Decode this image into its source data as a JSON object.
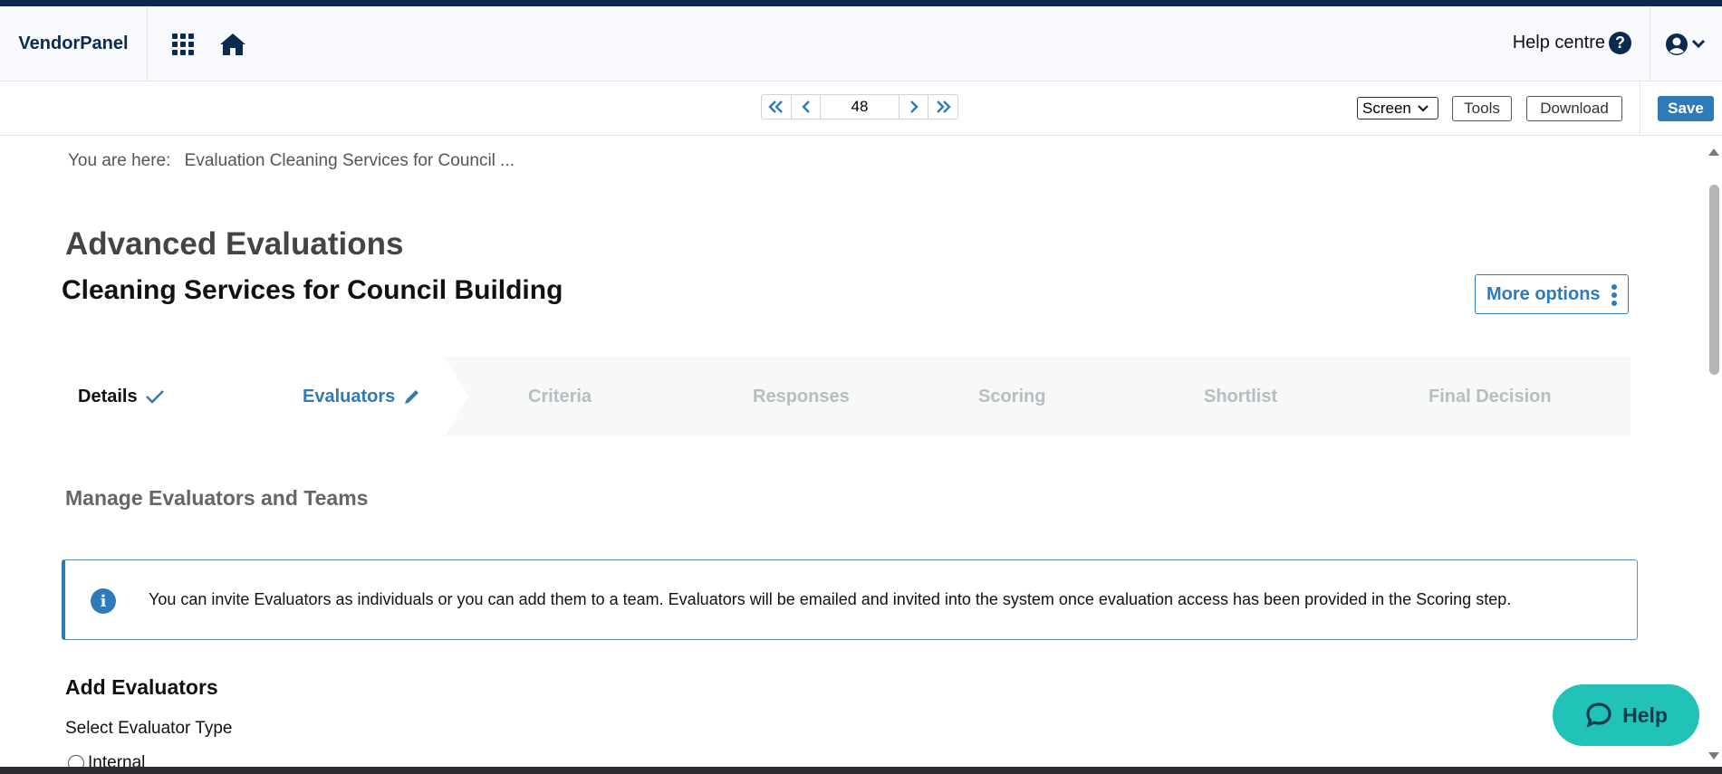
{
  "header": {
    "brand": "VendorPanel",
    "help_centre": "Help centre",
    "help_icon_glyph": "?"
  },
  "toolbar": {
    "page_number": "48",
    "view_select": "Screen",
    "tools_label": "Tools",
    "download_label": "Download",
    "save_label": "Save"
  },
  "breadcrumb": {
    "prefix": "You are here:",
    "current": "Evaluation Cleaning Services for Council ..."
  },
  "page": {
    "title": "Advanced Evaluations",
    "subtitle": "Cleaning Services for Council Building",
    "more_options_label": "More options"
  },
  "stepper": {
    "steps": [
      {
        "label": "Details",
        "state": "done"
      },
      {
        "label": "Evaluators",
        "state": "active"
      },
      {
        "label": "Criteria",
        "state": "future"
      },
      {
        "label": "Responses",
        "state": "future"
      },
      {
        "label": "Scoring",
        "state": "future"
      },
      {
        "label": "Shortlist",
        "state": "future"
      },
      {
        "label": "Final Decision",
        "state": "future"
      }
    ]
  },
  "content": {
    "section_title": "Manage Evaluators and Teams",
    "info_icon_glyph": "i",
    "info_text": "You can invite Evaluators as individuals or you can add them to a team. Evaluators will be emailed and invited into the system once evaluation access has been provided in the Scoring step.",
    "add_title": "Add Evaluators",
    "select_type_label": "Select Evaluator Type",
    "radio_internal": "Internal"
  },
  "help_fab": {
    "label": "Help"
  },
  "icons": {
    "apps": "apps-grid-icon",
    "home": "home-icon",
    "help": "question-circle-icon",
    "user": "user-circle-icon",
    "info": "info-circle-icon",
    "chat": "chat-bubble-icon"
  },
  "colors": {
    "brand_navy": "#0b2a4f",
    "accent_blue": "#2f7ab9",
    "help_teal": "#21c3b8",
    "inactive_step": "#b9bdc1"
  }
}
